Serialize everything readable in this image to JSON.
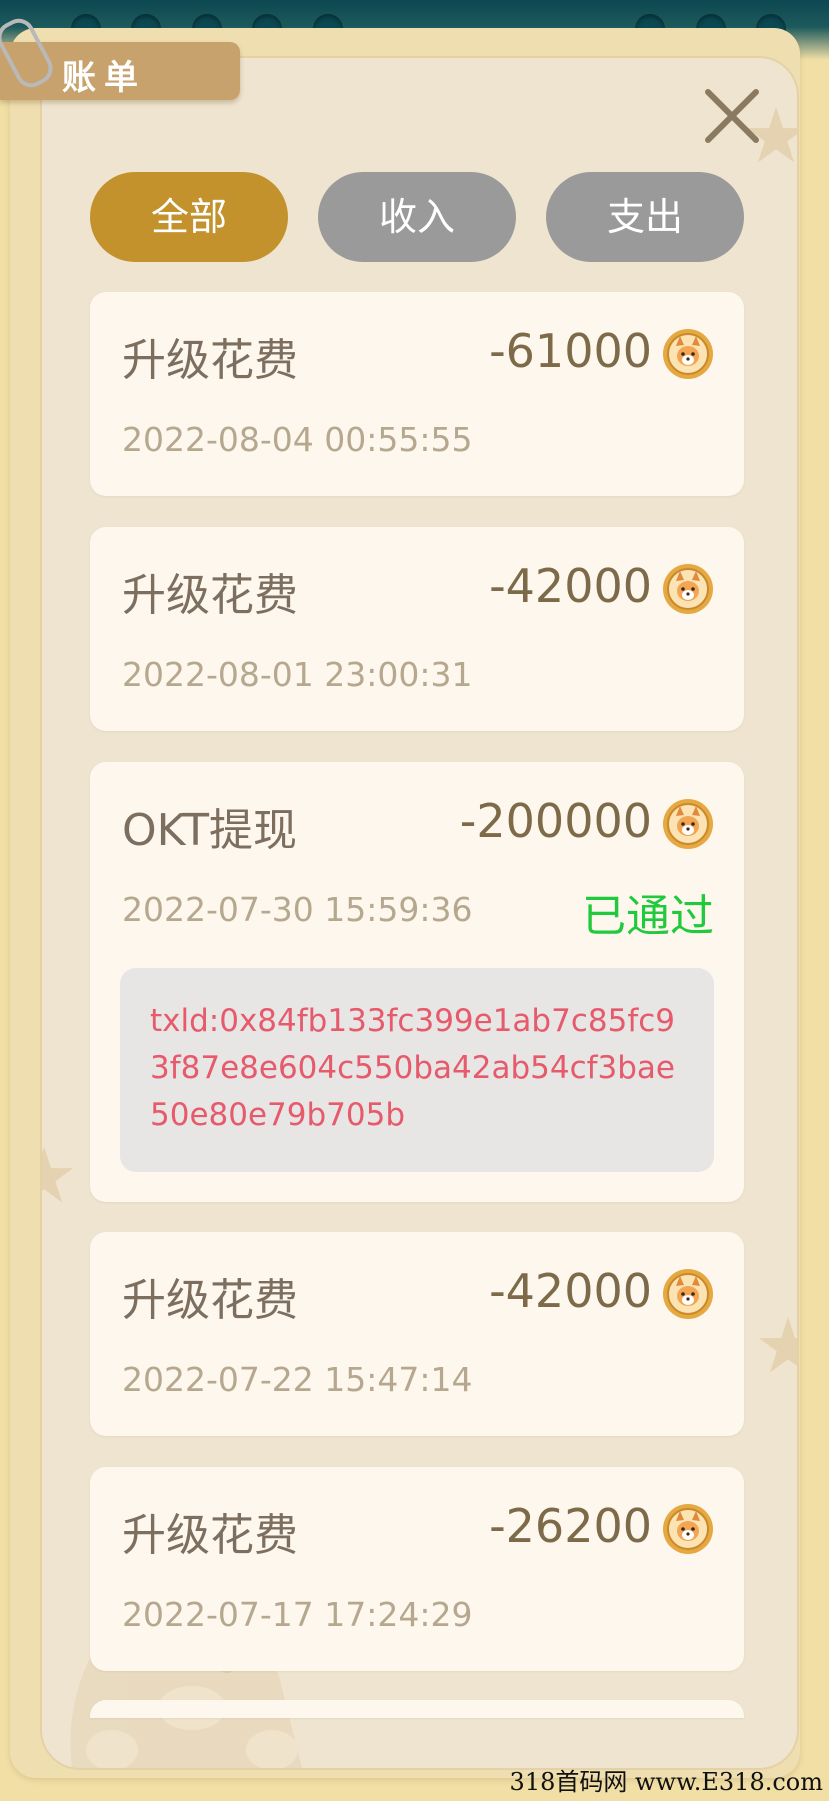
{
  "header": {
    "title": "账单",
    "close_icon": "close-icon"
  },
  "tabs": [
    {
      "label": "全部",
      "active": true
    },
    {
      "label": "收入",
      "active": false
    },
    {
      "label": "支出",
      "active": false
    }
  ],
  "records": [
    {
      "title": "升级花费",
      "amount": "-61000",
      "time": "2022-08-04 00:55:55",
      "icon": "coin-icon"
    },
    {
      "title": "升级花费",
      "amount": "-42000",
      "time": "2022-08-01 23:00:31",
      "icon": "coin-icon"
    },
    {
      "title": "OKT提现",
      "amount": "-200000",
      "time": "2022-07-30 15:59:36",
      "status": "已通过",
      "txid": "txld:0x84fb133fc399e1ab7c85fc93f87e8e604c550ba42ab54cf3bae50e80e79b705b",
      "icon": "coin-icon"
    },
    {
      "title": "升级花费",
      "amount": "-42000",
      "time": "2022-07-22 15:47:14",
      "icon": "coin-icon"
    },
    {
      "title": "升级花费",
      "amount": "-26200",
      "time": "2022-07-17 17:24:29",
      "icon": "coin-icon"
    }
  ],
  "watermark": "318首码网 www.E318.com",
  "colors": {
    "active_tab": "#c3922d",
    "inactive_tab": "#9a9a9a",
    "status_green": "#21c93d",
    "txid_red": "#e65a6c",
    "panel": "#efe4cf",
    "card": "#fef7ee"
  }
}
